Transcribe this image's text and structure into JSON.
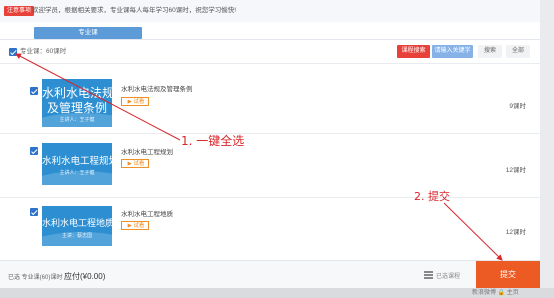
{
  "notice": {
    "tag": "注意事项",
    "text": "欢迎学员，根据相关要求，专业课每人每年学习60课时，祝您学习愉快!"
  },
  "tab": {
    "label": "专业课"
  },
  "toolbar": {
    "label": "专业课：60课时",
    "buttons": [
      "课程搜索",
      "请输入关键字",
      "搜索",
      "全部"
    ]
  },
  "courses": [
    {
      "thumb_title_1": "水利水电法规",
      "thumb_title_2": "及管理条例",
      "thumb_sub": "主讲人：王子健",
      "title": "水利水电法规及管理条例",
      "trial": "试看",
      "hours": "9课时"
    },
    {
      "thumb_title_1": "水利水电工程规划",
      "thumb_sub": "主讲人：王子健",
      "title": "水利水电工程规划",
      "trial": "试看",
      "hours": "12课时"
    },
    {
      "thumb_title_1": "水利水电工程地质",
      "thumb_sub": "主讲：蔡志国",
      "title": "水利水电工程地质",
      "trial": "试看",
      "hours": "12课时"
    }
  ],
  "footer": {
    "selected": "已选 专业课(60)课时",
    "price": "应付(¥0.00)",
    "list_label": "已选课程",
    "submit": "提交"
  },
  "bottom_strip": "新浪微博 🔒 主页",
  "annotations": {
    "select_all": "1. 一键全选",
    "submit": "2. 提交"
  },
  "colors": {
    "accent_blue": "#2e73c9",
    "tab_blue": "#5d9bd8",
    "submit_orange": "#ec5b24",
    "annotation_red": "#d8262b",
    "tag_red": "#e8413a"
  }
}
